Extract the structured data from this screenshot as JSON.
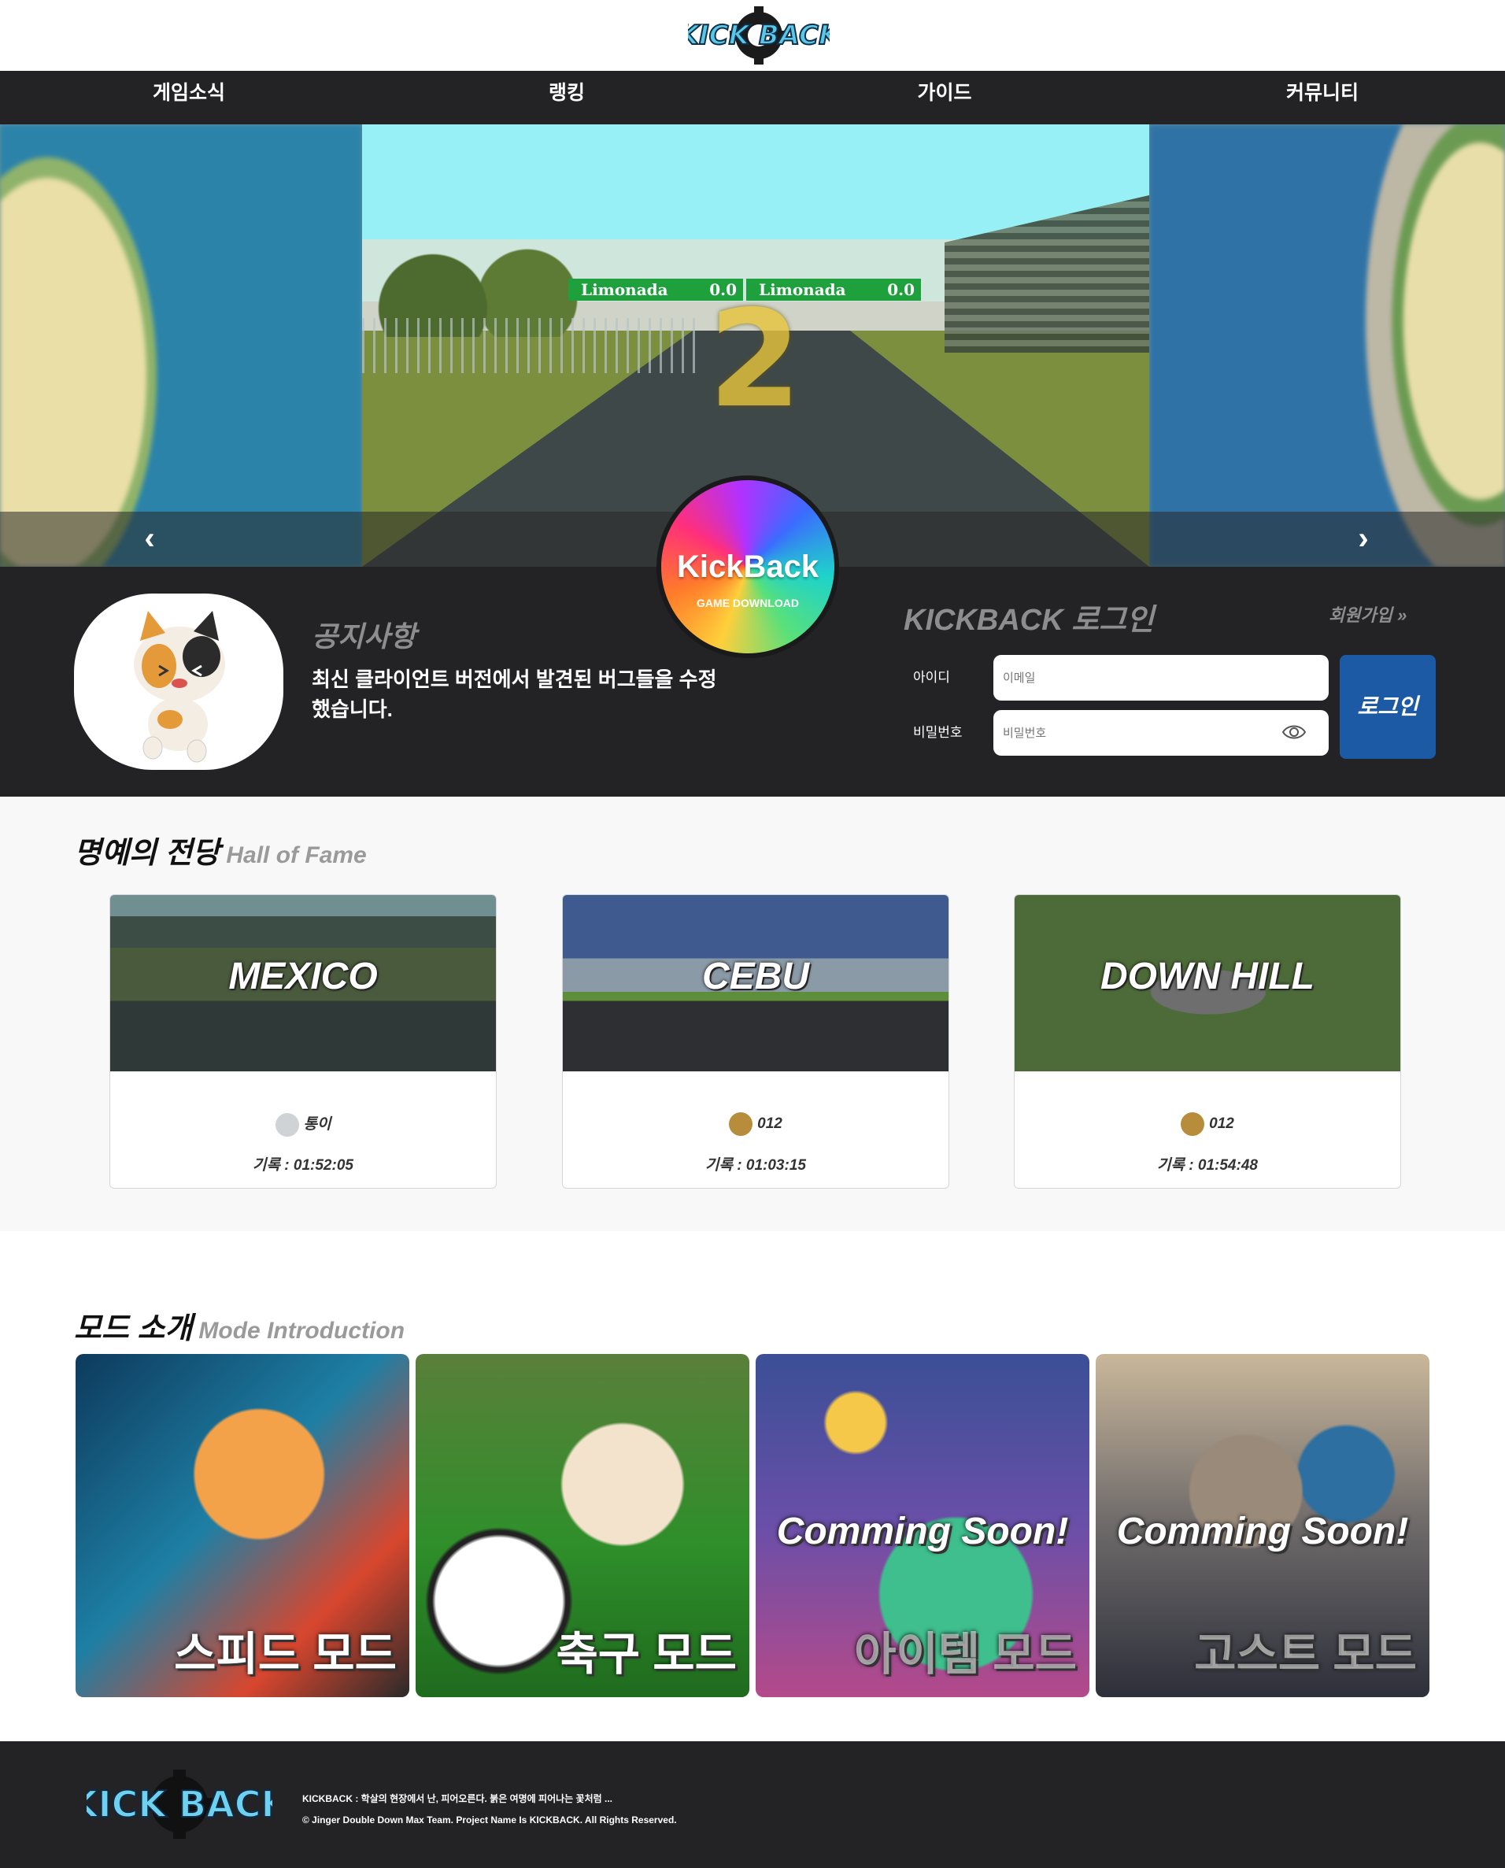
{
  "header": {
    "logo_text": "KICK BACK",
    "nav": [
      "게임소식",
      "랭킹",
      "가이드",
      "커뮤니티"
    ]
  },
  "hero": {
    "scoreboard_left": {
      "name": "Limonada",
      "value": "0.0"
    },
    "scoreboard_right": {
      "name": "Limonada",
      "value": "0.0"
    },
    "countdown": "2",
    "prev_arrow": "‹",
    "next_arrow": "›"
  },
  "download": {
    "title": "KickBack",
    "subtitle": "GAME DOWNLOAD"
  },
  "notice": {
    "title": "공지사항",
    "body": "최신 클라이언트 버전에서 발견된 버그들을 수정했습니다."
  },
  "login": {
    "title": "KICKBACK 로그인",
    "signup": "회원가입 »",
    "id_label": "아이디",
    "id_placeholder": "이메일",
    "pw_label": "비밀번호",
    "pw_placeholder": "비밀번호",
    "button": "로그인"
  },
  "hall_of_fame": {
    "title": "명예의 전당",
    "title_en": "Hall of Fame",
    "cards": [
      {
        "track": "MEXICO",
        "user": "통이",
        "record": "기록 : 01:52:05"
      },
      {
        "track": "CEBU",
        "user": "012",
        "record": "기록 : 01:03:15"
      },
      {
        "track": "DOWN HILL",
        "user": "012",
        "record": "기록 : 01:54:48"
      }
    ]
  },
  "modes": {
    "title": "모드 소개",
    "title_en": "Mode Introduction",
    "items": [
      {
        "label": "스피드 모드",
        "overlay": ""
      },
      {
        "label": "축구 모드",
        "overlay": ""
      },
      {
        "label": "아이템 모드",
        "overlay": "Comming Soon!"
      },
      {
        "label": "고스트 모드",
        "overlay": "Comming Soon!"
      }
    ]
  },
  "footer": {
    "logo_text": "KICK BACK",
    "line1": "KICKBACK : 학살의 현장에서 난, 피어오른다. 붉은 여명에 피어나는 꽃처럼 ...",
    "line2": "© Jinger Double Down Max Team. Project Name Is KICKBACK. All Rights Reserved."
  }
}
